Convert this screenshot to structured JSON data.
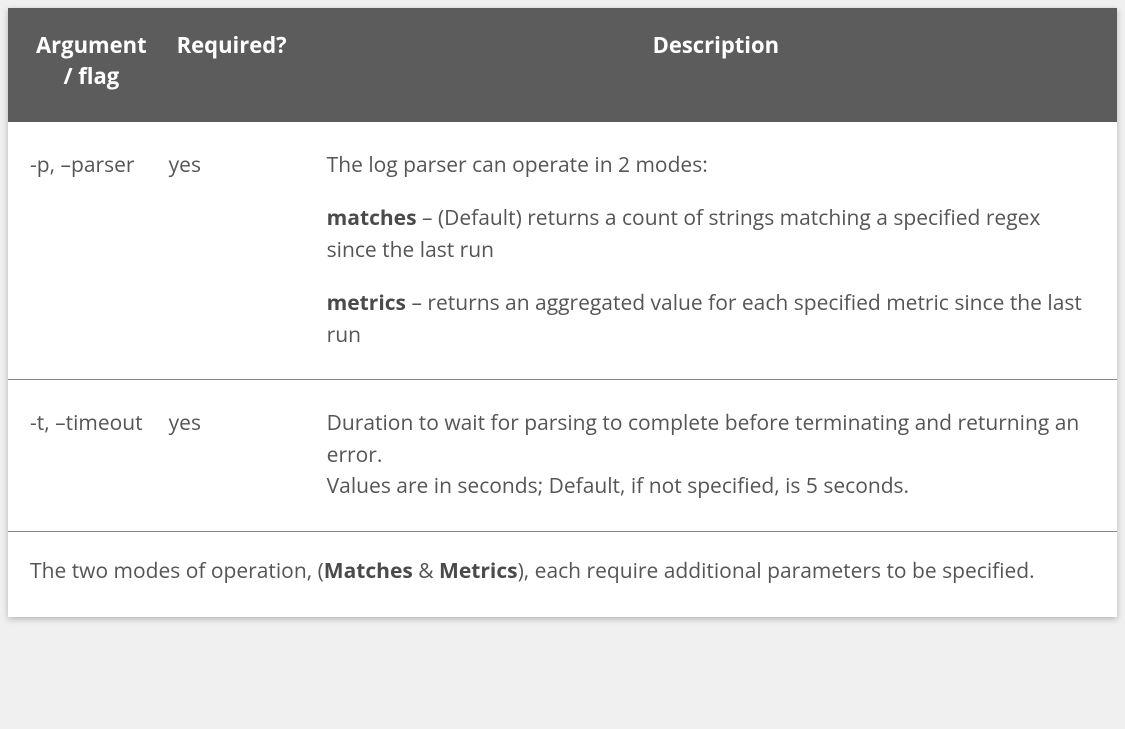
{
  "headers": {
    "col1": "Argument / flag",
    "col2": "Required?",
    "col3": "Description"
  },
  "rows": [
    {
      "arg": "-p, –parser",
      "required": "yes",
      "desc_intro": "The log parser can operate in 2 modes:",
      "mode1_label": "matches",
      "mode1_text": " – (Default) returns a count of strings matching a specified regex since the last run",
      "mode2_label": "metrics",
      "mode2_text": " – returns an aggregated value for each specified metric since the last run"
    },
    {
      "arg": "-t, –timeout",
      "required": "yes",
      "desc_line1": "Duration to wait for parsing to complete before terminating and returning an error.",
      "desc_line2": "Values are in seconds; Default, if not specified, is 5 seconds."
    }
  ],
  "footer": {
    "pre": "The two modes of operation, (",
    "bold1": "Matches",
    "amp": " & ",
    "bold2": "Metrics",
    "post": "), each require additional parameters to be specified."
  }
}
